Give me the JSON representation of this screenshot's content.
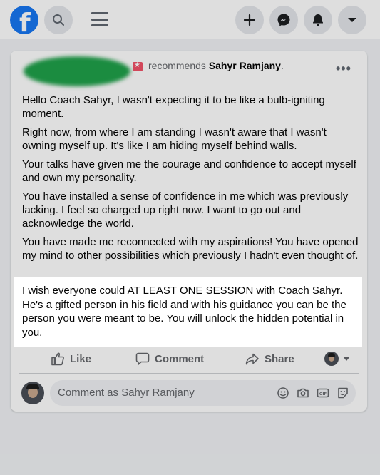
{
  "post": {
    "recommends_text": "recommends",
    "page_name": "Sahyr Ramjany",
    "page_name_suffix": ".",
    "more_label": "•••",
    "paragraphs": [
      "Hello Coach Sahyr, I wasn't expecting it to be like a bulb-igniting moment.",
      "Right now, from where I am standing I wasn't aware that I wasn't owning myself up. It's like I am hiding myself behind walls.",
      "Your talks have given me the courage and confidence to accept myself and own my personality.",
      "You have installed a sense of confidence in me which was previously lacking. I feel so charged up right now. I want to go out and acknowledge the world.",
      "You have made me reconnected with my aspirations!  You have opened my mind to other possibilities which previously I hadn't even thought of."
    ],
    "highlighted_paragraph": "I wish everyone could AT LEAST ONE SESSION with Coach Sahyr. He's a gifted person in his field and with his guidance you can be the person you were meant to be. You will unlock the hidden potential in you."
  },
  "actions": {
    "like": "Like",
    "comment": "Comment",
    "share": "Share"
  },
  "composer": {
    "placeholder": "Comment as Sahyr Ramjany",
    "icons": [
      "emoji-icon",
      "camera-icon",
      "gif-icon",
      "sticker-icon"
    ]
  },
  "colors": {
    "brand": "#1877f2",
    "recommend_badge": "#f25268",
    "muted_text": "#65676b"
  }
}
